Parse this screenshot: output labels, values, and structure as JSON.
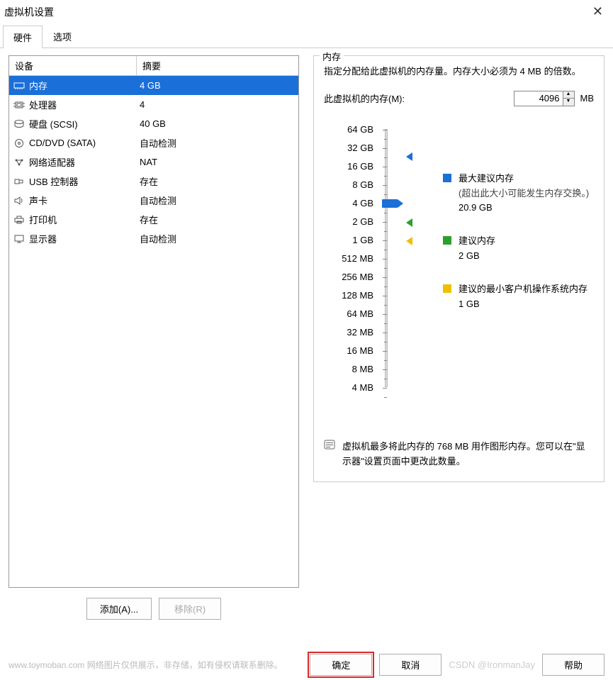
{
  "window": {
    "title": "虚拟机设置"
  },
  "tabs": {
    "hardware": "硬件",
    "options": "选项"
  },
  "deviceTable": {
    "headerDevice": "设备",
    "headerSummary": "摘要",
    "rows": [
      {
        "icon": "memory",
        "name": "内存",
        "summary": "4 GB",
        "selected": true
      },
      {
        "icon": "cpu",
        "name": "处理器",
        "summary": "4"
      },
      {
        "icon": "disk",
        "name": "硬盘 (SCSI)",
        "summary": "40 GB"
      },
      {
        "icon": "cd",
        "name": "CD/DVD (SATA)",
        "summary": "自动检测"
      },
      {
        "icon": "net",
        "name": "网络适配器",
        "summary": "NAT"
      },
      {
        "icon": "usb",
        "name": "USB 控制器",
        "summary": "存在"
      },
      {
        "icon": "sound",
        "name": "声卡",
        "summary": "自动检测"
      },
      {
        "icon": "printer",
        "name": "打印机",
        "summary": "存在"
      },
      {
        "icon": "display",
        "name": "显示器",
        "summary": "自动检测"
      }
    ]
  },
  "leftButtons": {
    "add": "添加(A)...",
    "remove": "移除(R)"
  },
  "memory": {
    "legend": "内存",
    "desc": "指定分配给此虚拟机的内存量。内存大小必须为 4 MB 的倍数。",
    "inputLabel": "此虚拟机的内存(M):",
    "value": "4096",
    "unit": "MB",
    "sliderTicks": [
      "64 GB",
      "32 GB",
      "16 GB",
      "8 GB",
      "4 GB",
      "2 GB",
      "1 GB",
      "512 MB",
      "256 MB",
      "128 MB",
      "64 MB",
      "32 MB",
      "16 MB",
      "8 MB",
      "4 MB"
    ],
    "markers": {
      "maxRecommended": {
        "color": "blue",
        "label": "最大建议内存",
        "sub": "(超出此大小可能发生内存交换。)",
        "value": "20.9 GB"
      },
      "recommended": {
        "color": "green",
        "label": "建议内存",
        "value": "2 GB"
      },
      "minGuest": {
        "color": "yellow",
        "label": "建议的最小客户机操作系统内存",
        "value": "1 GB"
      }
    },
    "note": "虚拟机最多将此内存的 768 MB 用作图形内存。您可以在\"显示器\"设置页面中更改此数量。"
  },
  "bottom": {
    "ok": "确定",
    "cancel": "取消",
    "help": "帮助"
  },
  "watermarks": {
    "left": "www.toymoban.com 网络图片仅供展示，非存储，如有侵权请联系删除。",
    "csdn": "CSDN @IronmanJay"
  }
}
